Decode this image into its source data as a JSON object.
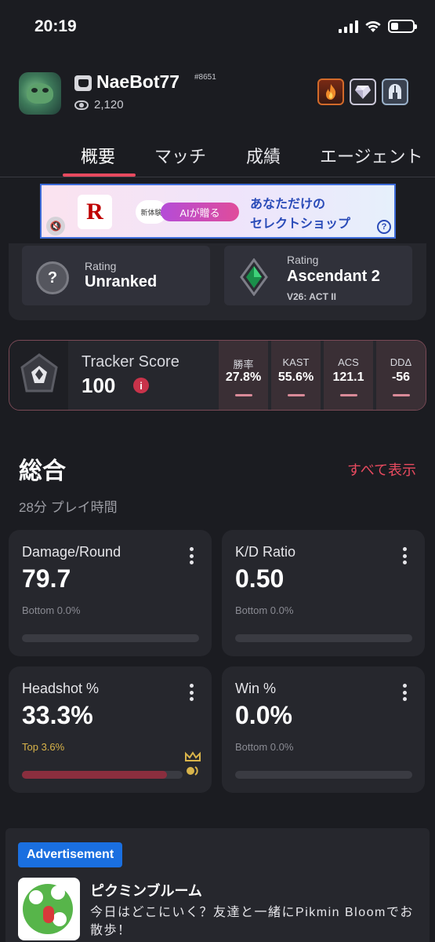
{
  "status_bar": {
    "time": "20:19"
  },
  "profile": {
    "username": "NaeBot77",
    "tag": "#8651",
    "views": "2,120"
  },
  "colors": {
    "background": "#1b1c21",
    "card": "#26272d",
    "accent": "#e84a5f",
    "top_rank": "#d9b44a",
    "ad_label": "#1a6fe0"
  },
  "tabs": [
    {
      "label": "概要",
      "active": true
    },
    {
      "label": "マッチ",
      "active": false
    },
    {
      "label": "成績",
      "active": false
    },
    {
      "label": "エージェント",
      "active": false
    }
  ],
  "banner_ad": {
    "new_label": "新体験",
    "pill": "AIが贈る",
    "copy_line1": "あなただけの",
    "copy_line2": "セレクトショップ",
    "info": "?"
  },
  "ratings": [
    {
      "label": "Rating",
      "value": "Unranked",
      "icon": "unranked-question-icon"
    },
    {
      "label": "Rating",
      "value": "Ascendant 2",
      "sub": "V26: ACT II",
      "icon": "ascendant-rank-icon"
    }
  ],
  "tracker": {
    "label": "Tracker Score",
    "value": "100",
    "info": "i",
    "mini_stats": [
      {
        "label": "勝率",
        "value": "27.8%"
      },
      {
        "label": "KAST",
        "value": "55.6%"
      },
      {
        "label": "ACS",
        "value": "121.1"
      },
      {
        "label": "DDΔ",
        "value": "-56"
      }
    ]
  },
  "overview": {
    "title": "総合",
    "see_all": "すべて表示",
    "playtime": "28分 プレイ時間"
  },
  "stats": [
    {
      "title": "Damage/Round",
      "value": "79.7",
      "rank": "Bottom 0.0%",
      "fill_pct": 0
    },
    {
      "title": "K/D Ratio",
      "value": "0.50",
      "rank": "Bottom 0.0%",
      "fill_pct": 0
    },
    {
      "title": "Headshot %",
      "value": "33.3%",
      "rank": "Top 3.6%",
      "fill_pct": 90
    },
    {
      "title": "Win %",
      "value": "0.0%",
      "rank": "Bottom 0.0%",
      "fill_pct": 0
    }
  ],
  "advertisement": {
    "label": "Advertisement",
    "app_name": "ピクミンブルーム",
    "description": "今日はどこにいく？友達と一緒にPikmin Bloomでお散歩！"
  }
}
